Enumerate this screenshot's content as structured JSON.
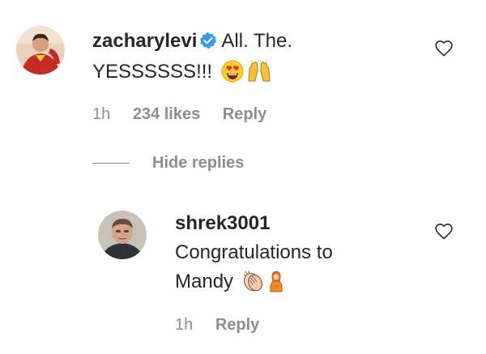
{
  "comment": {
    "username": "zacharylevi",
    "text_line1": "All. The.",
    "text_line2": "YESSSSSS!!!",
    "emojis": [
      "heart-eyes-emoji",
      "raising-hands-emoji"
    ],
    "time": "1h",
    "likes": "234 likes",
    "reply_label": "Reply"
  },
  "thread": {
    "hide_replies_label": "Hide replies"
  },
  "reply": {
    "username": "shrek3001",
    "text_line1": "Congratulations to",
    "text_line2": "Mandy",
    "emojis": [
      "clapping-hands-emoji",
      "person-emoji"
    ],
    "time": "1h",
    "reply_label": "Reply"
  },
  "colors": {
    "text": "#262626",
    "secondary": "#8e8e8e",
    "verified": "#3897f0"
  }
}
